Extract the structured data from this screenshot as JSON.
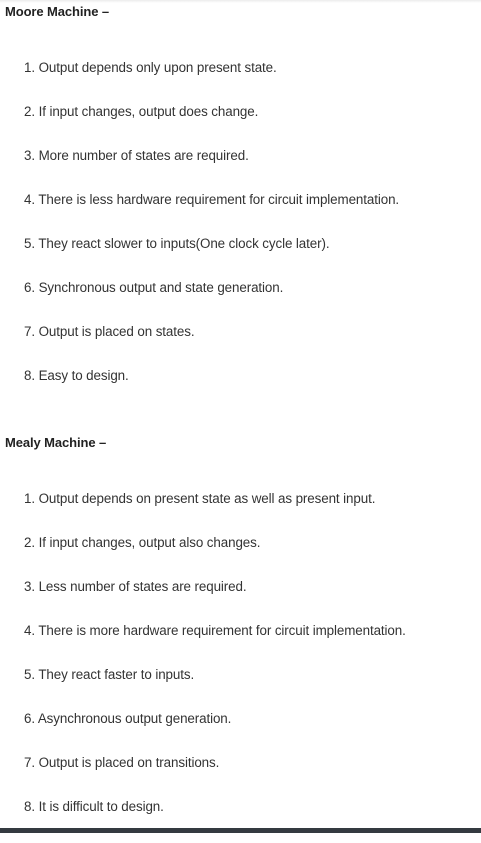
{
  "sections": [
    {
      "title": "Moore Machine –",
      "items": [
        "1. Output depends only upon present state.",
        "2. If input changes, output does change.",
        "3. More number of states are required.",
        "4. There is less hardware requirement for circuit implementation.",
        "5. They react slower to inputs(One clock cycle later).",
        "6. Synchronous output and state generation.",
        "7. Output is placed on states.",
        "8. Easy to design."
      ]
    },
    {
      "title": "Mealy Machine –",
      "items": [
        "1. Output depends on present state as well as present input.",
        "2. If input changes, output also changes.",
        "3. Less number of states are required.",
        "4. There is more hardware requirement for circuit implementation.",
        "5. They react faster to inputs.",
        "6. Asynchronous output generation.",
        "7. Output is placed on transitions.",
        "8. It is difficult to design."
      ]
    }
  ]
}
